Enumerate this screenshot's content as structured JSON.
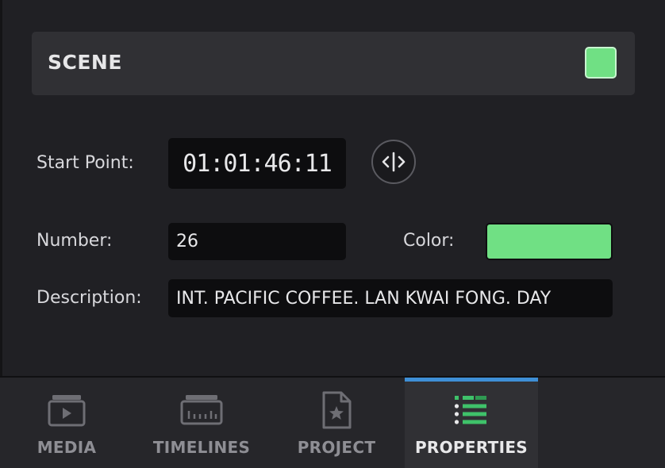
{
  "scene": {
    "title": "SCENE",
    "color": "#70e084"
  },
  "fields": {
    "start_point_label": "Start Point:",
    "start_point_value": "01:01:46:11",
    "number_label": "Number:",
    "number_value": "26",
    "color_label": "Color:",
    "color_value": "#70e084",
    "description_label": "Description:",
    "description_value": "INT. PACIFIC COFFEE. LAN KWAI FONG. DAY"
  },
  "tabs": [
    {
      "label": "MEDIA",
      "icon": "media-icon",
      "active": false
    },
    {
      "label": "TIMELINES",
      "icon": "timeline-icon",
      "active": false
    },
    {
      "label": "PROJECT",
      "icon": "project-icon",
      "active": false
    },
    {
      "label": "PROPERTIES",
      "icon": "properties-icon",
      "active": true
    }
  ],
  "colors": {
    "accent": "#3e8fd6",
    "scene_green": "#70e084"
  }
}
